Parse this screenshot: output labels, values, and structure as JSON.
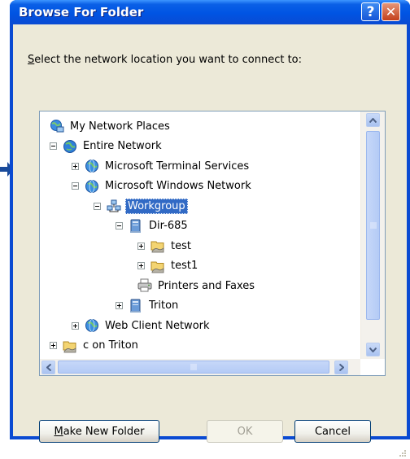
{
  "window": {
    "title": "Browse For Folder",
    "help_glyph": "?",
    "close_glyph": "✕"
  },
  "prompt": {
    "accel": "S",
    "text_rest": "elect the network location you want to connect to:"
  },
  "tree": {
    "items": [
      {
        "label": "My Network Places",
        "icon": "network-places-icon",
        "expander": "none",
        "depth": 0
      },
      {
        "label": "Entire Network",
        "icon": "globe-icon",
        "expander": "minus",
        "depth": 0
      },
      {
        "label": "Microsoft Terminal Services",
        "icon": "network-globe-icon",
        "expander": "plus",
        "depth": 1
      },
      {
        "label": "Microsoft Windows Network",
        "icon": "network-globe-icon",
        "expander": "minus",
        "depth": 1
      },
      {
        "label": "Workgroup",
        "icon": "workgroup-icon",
        "expander": "minus",
        "depth": 2,
        "selected": true
      },
      {
        "label": "Dir-685",
        "icon": "computer-icon",
        "expander": "minus",
        "depth": 3
      },
      {
        "label": "test",
        "icon": "shared-folder-icon",
        "expander": "plus",
        "depth": 4
      },
      {
        "label": "test1",
        "icon": "shared-folder-icon",
        "expander": "plus",
        "depth": 4
      },
      {
        "label": "Printers and Faxes",
        "icon": "printers-icon",
        "expander": "none",
        "depth": 4
      },
      {
        "label": "Triton",
        "icon": "computer-icon",
        "expander": "plus",
        "depth": 3
      },
      {
        "label": "Web Client Network",
        "icon": "network-globe-icon",
        "expander": "plus",
        "depth": 1
      },
      {
        "label": "c on Triton",
        "icon": "shared-folder-icon",
        "expander": "plus",
        "depth": 0
      }
    ]
  },
  "buttons": {
    "make_new_folder_accel": "M",
    "make_new_folder_rest": "ake New Folder",
    "ok": "OK",
    "cancel": "Cancel"
  },
  "colors": {
    "titlebar": "#0054e3",
    "selection": "#316ac5",
    "dialog_face": "#ece9d8"
  }
}
